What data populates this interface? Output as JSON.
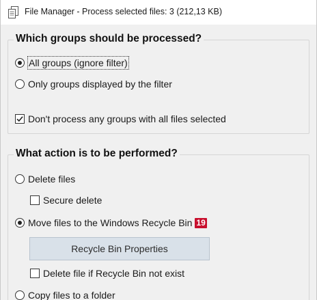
{
  "window": {
    "title": "File Manager - Process selected files: 3 (212,13 KB)",
    "icon": "file-manager-icon"
  },
  "groups_section": {
    "title": "Which groups should be processed?",
    "options": [
      {
        "label": "All groups (ignore filter)",
        "checked": true
      },
      {
        "label": "Only groups displayed by the filter",
        "checked": false
      }
    ],
    "skip_all_selected": {
      "label": "Don't process any groups with all files selected",
      "checked": true
    }
  },
  "action_section": {
    "title": "What action is to be performed?",
    "delete_files": {
      "label": "Delete files",
      "checked": false
    },
    "secure_delete": {
      "label": "Secure delete",
      "checked": false
    },
    "move_recycle": {
      "label": "Move files to the Windows Recycle Bin",
      "checked": true,
      "badge": "19"
    },
    "recycle_properties_button": "Recycle Bin Properties",
    "delete_if_no_bin": {
      "label": "Delete file if Recycle Bin not exist",
      "checked": false
    },
    "copy_to_folder": {
      "label": "Copy files to a folder",
      "checked": false
    }
  },
  "colors": {
    "badge": "#c8102e",
    "button_bg": "#d9e1e9",
    "panel_bg": "#f0f0f0"
  }
}
